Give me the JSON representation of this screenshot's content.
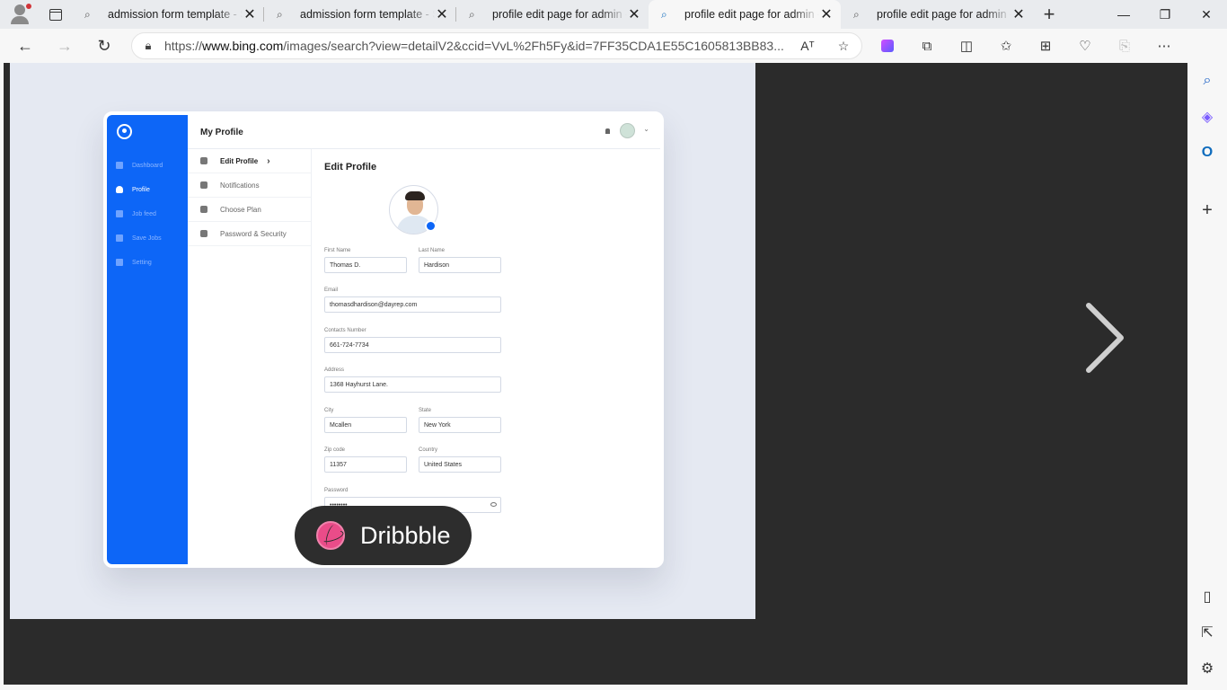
{
  "browser": {
    "tabs": [
      {
        "title": "admission form template - Search"
      },
      {
        "title": "admission form template - Search"
      },
      {
        "title": "profile edit page for admin - Search"
      },
      {
        "title": "profile edit page for admin - Search"
      },
      {
        "title": "profile edit page for admin - Search"
      }
    ],
    "url_prefix": "https://",
    "url_host": "www.bing.com",
    "url_rest": "/images/search?view=detailV2&ccid=VvL%2Fh5Fy&id=7FF35CDA1E55C1605813BB83...",
    "read_aloud": "Aᵀ"
  },
  "image": {
    "app_title": "My Profile",
    "nav": [
      {
        "label": "Dashboard"
      },
      {
        "label": "Profile"
      },
      {
        "label": "Job feed"
      },
      {
        "label": "Save Jobs"
      },
      {
        "label": "Setting"
      }
    ],
    "menu": [
      {
        "label": "Edit Profile"
      },
      {
        "label": "Notifications"
      },
      {
        "label": "Choose Plan"
      },
      {
        "label": "Password & Security"
      }
    ],
    "form_title": "Edit Profile",
    "fields": {
      "first_name": {
        "label": "First Name",
        "value": "Thomas D."
      },
      "last_name": {
        "label": "Last Name",
        "value": "Hardison"
      },
      "email": {
        "label": "Email",
        "value": "thomasdhardison@dayrep.com"
      },
      "contact": {
        "label": "Contacts Number",
        "value": "661-724-7734"
      },
      "address": {
        "label": "Address",
        "value": "1368  Hayhurst Lane."
      },
      "city": {
        "label": "City",
        "value": "Mcallen"
      },
      "state": {
        "label": "State",
        "value": "New York"
      },
      "zip": {
        "label": "Zip code",
        "value": "11357"
      },
      "country": {
        "label": "Country",
        "value": "United States"
      },
      "password": {
        "label": "Password",
        "value": "••••••••"
      }
    }
  },
  "badge": {
    "text": "Dribbble"
  }
}
